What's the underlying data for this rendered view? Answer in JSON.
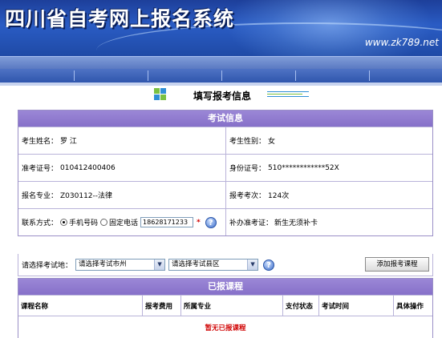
{
  "banner": {
    "title": "四川省自考网上报名系统",
    "url": "www.zk789.net"
  },
  "page": {
    "heading": "填写报考信息"
  },
  "exam_info": {
    "title": "考试信息",
    "name_label": "考生姓名：",
    "name_value": "罗 江",
    "gender_label": "考生性别：",
    "gender_value": "女",
    "ticket_label": "准考证号：",
    "ticket_value": "010412400406",
    "id_label": "身份证号：",
    "id_value": "510************52X",
    "major_label": "报名专业：",
    "major_value": "Z030112--法律",
    "count_label": "报考考次：",
    "count_value": "124次",
    "contact_label": "联系方式：",
    "mobile_label": "手机号码",
    "landline_label": "固定电话",
    "phone_value": "18628171233",
    "required_mark": "*",
    "help_glyph": "?",
    "reissue_label": "补办准考证：",
    "reissue_value": "新生无须补卡",
    "contact_selected": "mobile"
  },
  "exam_location": {
    "label": "请选择考试地：",
    "city_selected": "请选择考试市州",
    "county_selected": "请选择考试县区",
    "add_button": "添加报考课程",
    "help_glyph": "?"
  },
  "registered": {
    "title": "已报课程",
    "columns": [
      "课程名称",
      "报考费用",
      "所属专业",
      "支付状态",
      "考试时间",
      "具体操作"
    ],
    "empty_text": "暂无已报课程"
  },
  "colors": {
    "banner": "#2a5cc4",
    "panel_header": "#8670c9",
    "empty_text": "#d00000"
  }
}
